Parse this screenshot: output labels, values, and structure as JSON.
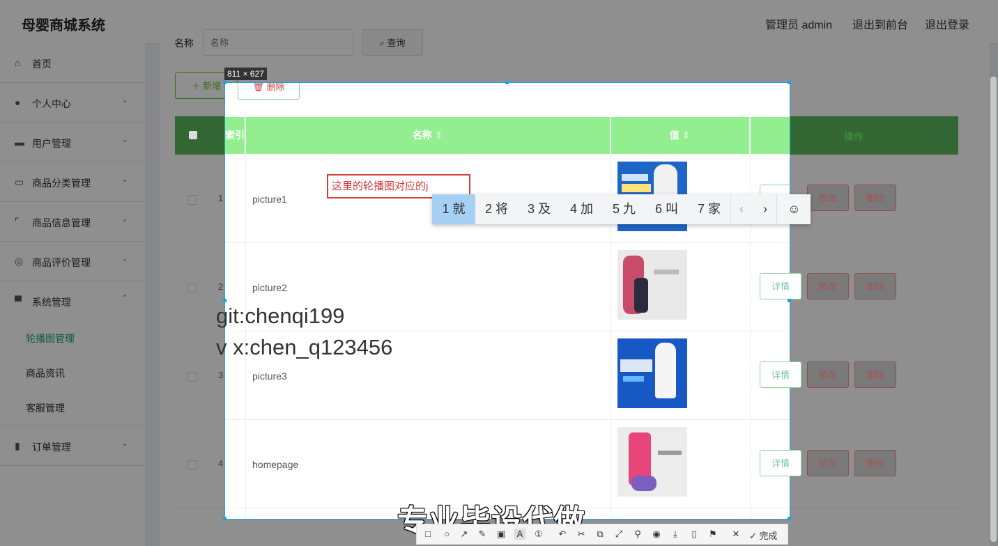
{
  "app": {
    "title": "母婴商城系统"
  },
  "header": {
    "admin_label": "管理员 admin",
    "front_label": "退出到前台",
    "logout_label": "退出登录"
  },
  "sidebar": {
    "items": [
      {
        "label": "首页",
        "icon": "home-icon"
      },
      {
        "label": "个人中心",
        "icon": "user-icon"
      },
      {
        "label": "用户管理",
        "icon": "briefcase-icon"
      },
      {
        "label": "商品分类管理",
        "icon": "chat-icon"
      },
      {
        "label": "商品信息管理",
        "icon": "frame-icon"
      },
      {
        "label": "商品评价管理",
        "icon": "compass-icon"
      },
      {
        "label": "系统管理",
        "icon": "cards-icon"
      },
      {
        "label": "订单管理",
        "icon": "bar-chart-icon"
      }
    ],
    "sub_items": [
      "轮播图管理",
      "商品资讯",
      "客服管理"
    ]
  },
  "search": {
    "label": "名称",
    "placeholder": "名称",
    "button": "查询"
  },
  "toolbar": {
    "add": "新增",
    "delete": "删除"
  },
  "table": {
    "headers": {
      "index": "索引",
      "name": "名称",
      "value": "值",
      "ops": "操作"
    },
    "rows": [
      {
        "index": "1",
        "name": "picture1"
      },
      {
        "index": "2",
        "name": "picture2"
      },
      {
        "index": "3",
        "name": "picture3"
      },
      {
        "index": "4",
        "name": "homepage"
      }
    ],
    "actions": {
      "detail": "详情",
      "edit": "修改",
      "delete": "删除"
    }
  },
  "screenshot_tool": {
    "size": "811 × 627",
    "done": "完成"
  },
  "ime": {
    "input_text": "这里的轮播图对应的j",
    "candidates": [
      "1 就",
      "2 将",
      "3 及",
      "4 加",
      "5 九",
      "6 叫",
      "7 家"
    ]
  },
  "watermark": {
    "git": "git:chenqi199",
    "wx": "v x:chen_q123456",
    "slogan": "专业毕设代做"
  },
  "colors": {
    "accent": "#1f9d6b",
    "header_green": "#92ee8e",
    "danger": "#d43b3b",
    "frame": "#1aa3e8"
  }
}
